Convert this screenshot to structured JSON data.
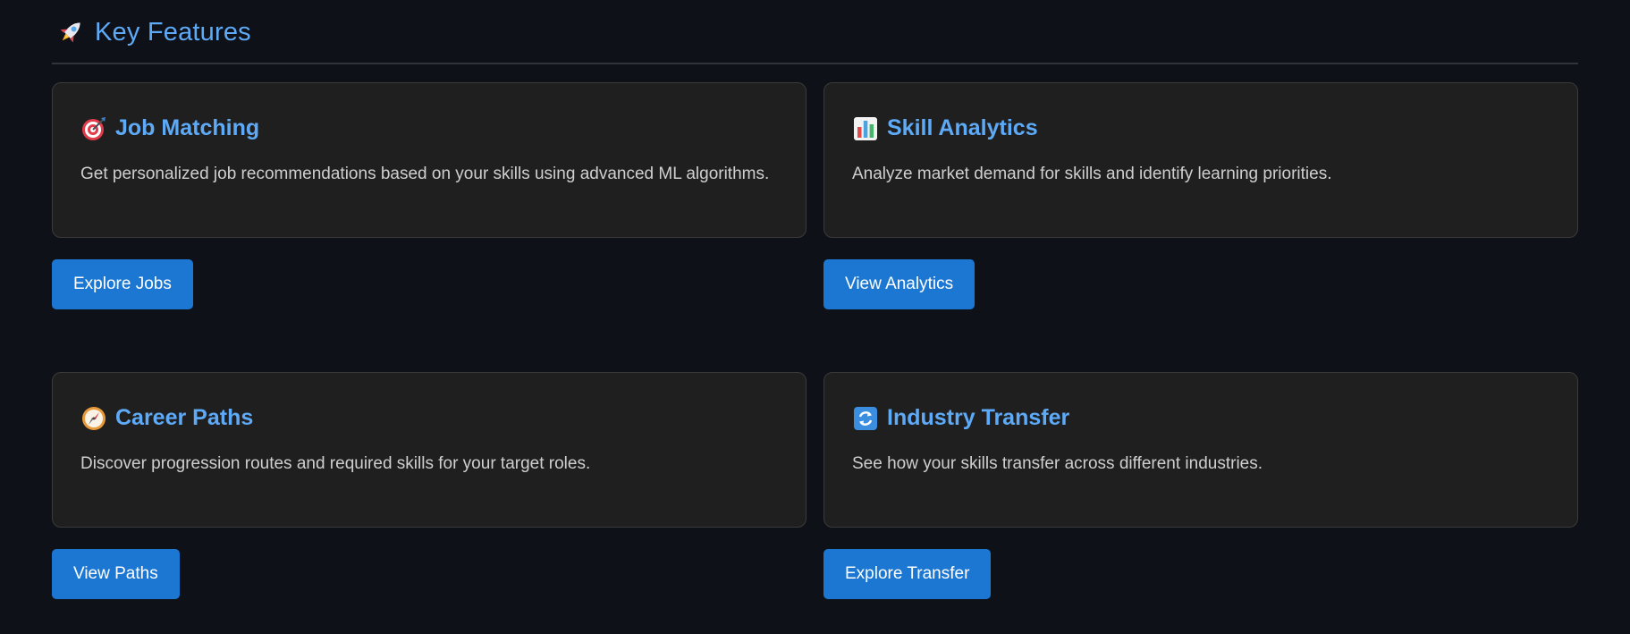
{
  "section": {
    "title": "Key Features",
    "icon": "rocket-icon"
  },
  "colors": {
    "background": "#0e1117",
    "accent": "#5eaaf7",
    "card_background": "#1f1f1f",
    "button": "#1b77d2"
  },
  "features": [
    {
      "icon": "target-icon",
      "title": "Job Matching",
      "description": "Get personalized job recommendations based on your skills using advanced ML algorithms.",
      "button_label": "Explore Jobs"
    },
    {
      "icon": "bar-chart-icon",
      "title": "Skill Analytics",
      "description": "Analyze market demand for skills and identify learning priorities.",
      "button_label": "View Analytics"
    },
    {
      "icon": "compass-icon",
      "title": "Career Paths",
      "description": "Discover progression routes and required skills for your target roles.",
      "button_label": "View Paths"
    },
    {
      "icon": "refresh-icon",
      "title": "Industry Transfer",
      "description": "See how your skills transfer across different industries.",
      "button_label": "Explore Transfer"
    }
  ]
}
